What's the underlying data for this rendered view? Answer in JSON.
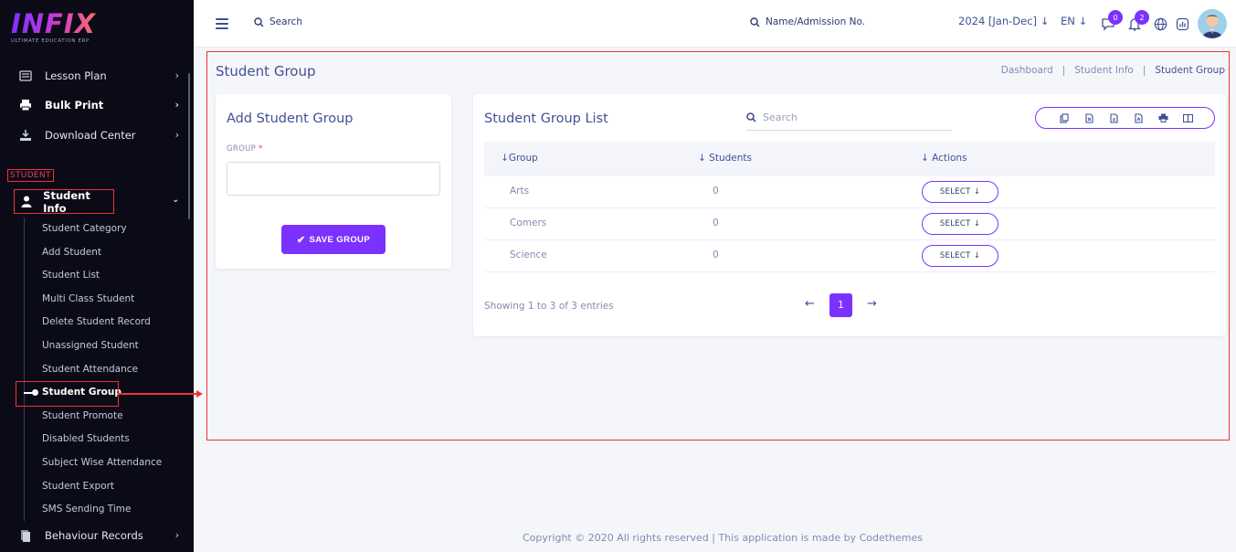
{
  "brand": {
    "logo": "INFIX",
    "tagline": "ULTIMATE EDUCATION ERP"
  },
  "sidebar": {
    "items_top": [
      {
        "label": "Lesson Plan",
        "icon": "list-icon"
      },
      {
        "label": "Bulk Print",
        "icon": "printer-icon"
      },
      {
        "label": "Download Center",
        "icon": "download-icon"
      }
    ],
    "section_label": "STUDENT",
    "student_info": {
      "label": "Student Info",
      "icon": "user-icon"
    },
    "sub_items": [
      "Student Category",
      "Add Student",
      "Student List",
      "Multi Class Student",
      "Delete Student Record",
      "Unassigned Student",
      "Student Attendance",
      "Student Group",
      "Student Promote",
      "Disabled Students",
      "Subject Wise Attendance",
      "Student Export",
      "SMS Sending Time"
    ],
    "bottom_item": {
      "label": "Behaviour Records",
      "icon": "behaviour-icon"
    }
  },
  "topbar": {
    "search_label": "Search",
    "search2_label": "Name/Admission No.",
    "year": "2024 [Jan-Dec]",
    "lang": "EN",
    "messages_count": "0",
    "notifications_count": "2"
  },
  "page": {
    "title": "Student Group",
    "breadcrumb": [
      "Dashboard",
      "Student Info",
      "Student Group"
    ]
  },
  "add_form": {
    "title": "Add Student Group",
    "group_label": "GROUP",
    "required_mark": "*",
    "save_label": "SAVE GROUP"
  },
  "list": {
    "title": "Student Group List",
    "search_placeholder": "Search",
    "columns": [
      "Group",
      "Students",
      "Actions"
    ],
    "rows": [
      {
        "group": "Arts",
        "students": "0",
        "action": "SELECT"
      },
      {
        "group": "Comers",
        "students": "0",
        "action": "SELECT"
      },
      {
        "group": "Science",
        "students": "0",
        "action": "SELECT"
      }
    ],
    "showing": "Showing 1 to 3 of 3 entries",
    "current_page": "1"
  },
  "footer": "Copyright © 2020 All rights reserved | This application is made by Codethemes",
  "colors": {
    "accent": "#7c32ff",
    "sidebar_bg": "#0b0b17",
    "highlight": "#ee3333",
    "text": "#415094"
  }
}
